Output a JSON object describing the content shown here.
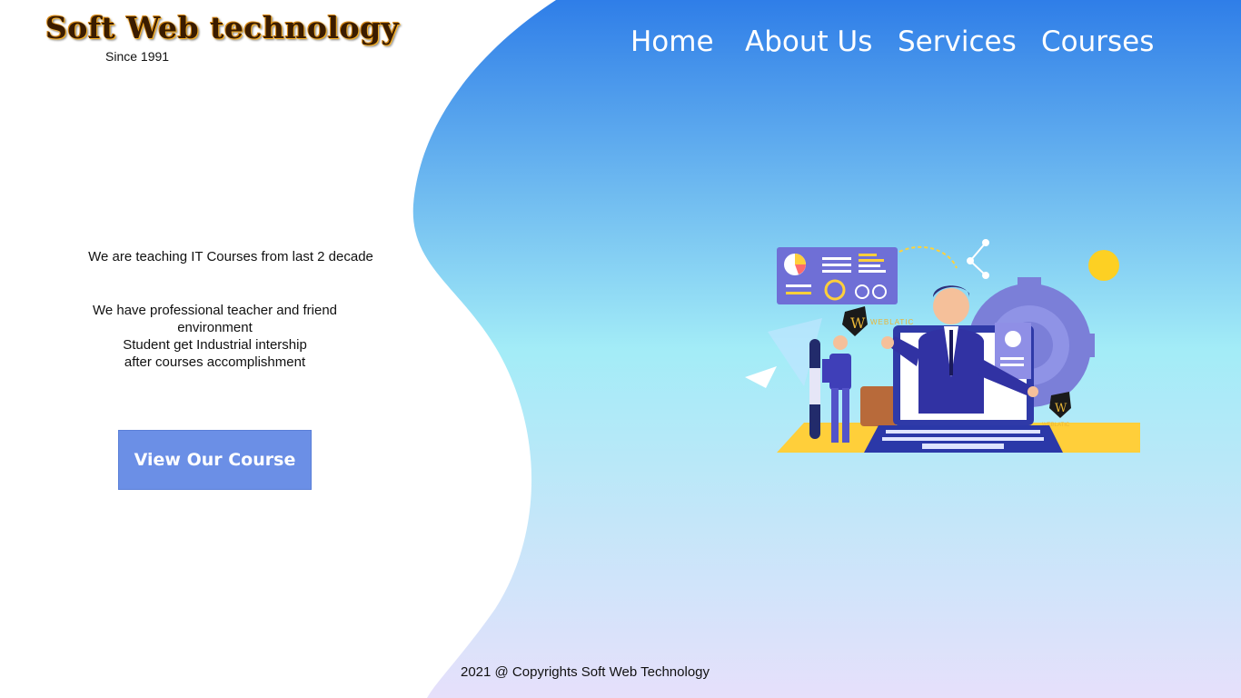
{
  "logo": {
    "title": "Soft Web technology",
    "subtitle": "Since 1991"
  },
  "nav": {
    "home": "Home",
    "about": "About Us",
    "services": "Services",
    "courses": "Courses"
  },
  "hero": {
    "tagline": "We  are teaching  IT Courses from last 2 decade",
    "desc_lines": [
      "We have professional teacher and friend",
      "environment",
      "Student get Industrial intership",
      "after courses accomplishment"
    ],
    "cta_label": "View Our Course"
  },
  "illustration": {
    "brand": "WEBLATIC",
    "badge_letter": "W"
  },
  "footer": {
    "copyright": "2021 @ Copyrights  Soft Web Technology"
  },
  "colors": {
    "gradient_top": "#2f7ee8",
    "gradient_mid": "#a3ecf7",
    "gradient_bottom": "#e6e0fb",
    "cta_bg": "#6b8fe6"
  }
}
